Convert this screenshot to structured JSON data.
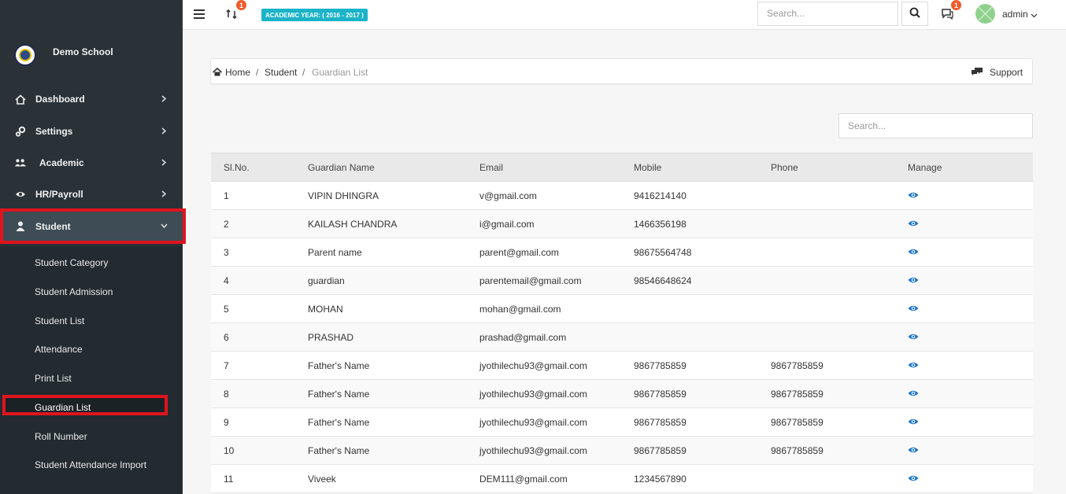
{
  "topbar": {
    "sync_badge": "1",
    "academic_year": "ACADEMIC YEAR: ( 2016 - 2017 )",
    "search_placeholder": "Search...",
    "chat_badge": "1",
    "user": "admin"
  },
  "sidebar": {
    "school_name": "Demo School",
    "nav": [
      {
        "label": "Dashboard",
        "icon": "home-icon"
      },
      {
        "label": "Settings",
        "icon": "cogs-icon"
      },
      {
        "label": "Academic",
        "icon": "users-icon"
      },
      {
        "label": "HR/Payroll",
        "icon": "eye-icon"
      },
      {
        "label": "Student",
        "icon": "user-icon"
      }
    ],
    "submenu": [
      "Student Category",
      "Student Admission",
      "Student List",
      "Attendance",
      "Print List",
      "Guardian List",
      "Roll Number",
      "Student Attendance Import"
    ],
    "active_nav": "Student",
    "active_sub": "Guardian List"
  },
  "breadcrumb": {
    "home": "Home",
    "sep": "/",
    "student": "Student",
    "current": "Guardian List",
    "support": "Support"
  },
  "table": {
    "search_placeholder": "Search...",
    "headers": [
      "Sl.No.",
      "Guardian Name",
      "Email",
      "Mobile",
      "Phone",
      "Manage"
    ],
    "rows": [
      {
        "no": "1",
        "name": "VIPIN DHINGRA",
        "email": "v@gmail.com",
        "mobile": "9416214140",
        "phone": ""
      },
      {
        "no": "2",
        "name": "KAILASH CHANDRA",
        "email": "i@gmail.com",
        "mobile": "1466356198",
        "phone": ""
      },
      {
        "no": "3",
        "name": "Parent name",
        "email": "parent@gmail.com",
        "mobile": "98675564748",
        "phone": ""
      },
      {
        "no": "4",
        "name": "guardian",
        "email": "parentemail@gmail.com",
        "mobile": "98546648624",
        "phone": ""
      },
      {
        "no": "5",
        "name": "MOHAN",
        "email": "mohan@gmail.com",
        "mobile": "",
        "phone": ""
      },
      {
        "no": "6",
        "name": "PRASHAD",
        "email": "prashad@gmail.com",
        "mobile": "",
        "phone": ""
      },
      {
        "no": "7",
        "name": "Father's Name",
        "email": "jyothilechu93@gmail.com",
        "mobile": "9867785859",
        "phone": "9867785859"
      },
      {
        "no": "8",
        "name": "Father's Name",
        "email": "jyothilechu93@gmail.com",
        "mobile": "9867785859",
        "phone": "9867785859"
      },
      {
        "no": "9",
        "name": "Father's Name",
        "email": "jyothilechu93@gmail.com",
        "mobile": "9867785859",
        "phone": "9867785859"
      },
      {
        "no": "10",
        "name": "Father's Name",
        "email": "jyothilechu93@gmail.com",
        "mobile": "9867785859",
        "phone": "9867785859"
      },
      {
        "no": "11",
        "name": "Viveek",
        "email": "DEM111@gmail.com",
        "mobile": "1234567890",
        "phone": ""
      }
    ]
  },
  "colors": {
    "sidebar_bg": "#2a3238",
    "highlight": "#e0141e",
    "accent": "#1bb3c8",
    "badge": "#f15a29",
    "eye": "#1a73c8"
  }
}
